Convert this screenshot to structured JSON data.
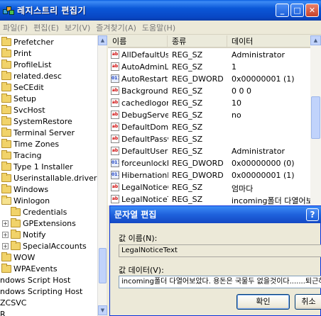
{
  "window": {
    "title": "레지스트리 편집기"
  },
  "menu": [
    {
      "label": "파일(F)"
    },
    {
      "label": "편집(E)"
    },
    {
      "label": "보기(V)"
    },
    {
      "label": "즐겨찾기(A)"
    },
    {
      "label": "도움말(H)"
    }
  ],
  "tree": {
    "items": [
      {
        "label": "Prefetcher"
      },
      {
        "label": "Print"
      },
      {
        "label": "ProfileList"
      },
      {
        "label": "related.desc"
      },
      {
        "label": "SeCEdit"
      },
      {
        "label": "Setup"
      },
      {
        "label": "SvcHost"
      },
      {
        "label": "SystemRestore"
      },
      {
        "label": "Terminal Server"
      },
      {
        "label": "Time Zones"
      },
      {
        "label": "Tracing"
      },
      {
        "label": "Type 1 Installer"
      },
      {
        "label": "Userinstallable.drivers"
      },
      {
        "label": "Windows"
      },
      {
        "label": "Winlogon"
      },
      {
        "label": "Credentials"
      },
      {
        "label": "GPExtensions"
      },
      {
        "label": "Notify"
      },
      {
        "label": "SpecialAccounts"
      },
      {
        "label": "WOW"
      },
      {
        "label": "WPAEvents"
      },
      {
        "label": "ndows Script Host"
      },
      {
        "label": "ndows Scripting Host"
      },
      {
        "label": "ZCSVC"
      },
      {
        "label": "R"
      }
    ]
  },
  "list": {
    "columns": {
      "name": "이름",
      "type": "종류",
      "data": "데이터"
    },
    "rows": [
      {
        "name": "AllDefaultUser...",
        "type": "REG_SZ",
        "data": "Administrator",
        "icon": "sz"
      },
      {
        "name": "AutoAdminLogon",
        "type": "REG_SZ",
        "data": "1",
        "icon": "sz"
      },
      {
        "name": "AutoRestartShell",
        "type": "REG_DWORD",
        "data": "0x00000001 (1)",
        "icon": "dw"
      },
      {
        "name": "Background",
        "type": "REG_SZ",
        "data": "0 0 0",
        "icon": "sz"
      },
      {
        "name": "cachedlogons...",
        "type": "REG_SZ",
        "data": "10",
        "icon": "sz"
      },
      {
        "name": "DebugServerC...",
        "type": "REG_SZ",
        "data": "no",
        "icon": "sz"
      },
      {
        "name": "DefaultDomain...",
        "type": "REG_SZ",
        "data": "",
        "icon": "sz"
      },
      {
        "name": "DefaultPassword",
        "type": "REG_SZ",
        "data": "",
        "icon": "sz"
      },
      {
        "name": "DefaultUserNa...",
        "type": "REG_SZ",
        "data": "Administrator",
        "icon": "sz"
      },
      {
        "name": "forceunlocklogon",
        "type": "REG_DWORD",
        "data": "0x00000000 (0)",
        "icon": "dw"
      },
      {
        "name": "HibernationPre...",
        "type": "REG_DWORD",
        "data": "0x00000001 (1)",
        "icon": "dw"
      },
      {
        "name": "LegalNoticeCa...",
        "type": "REG_SZ",
        "data": "엄마다",
        "icon": "sz"
      },
      {
        "name": "LegalNoticeText",
        "type": "REG_SZ",
        "data": "incoming폴더 다열어보았다.",
        "icon": "sz"
      }
    ]
  },
  "dialog": {
    "title": "문자열 편집",
    "help": "?",
    "name_label": "값 이름(N):",
    "name_value": "LegalNoticeText",
    "data_label": "값 데이터(V):",
    "data_value": "incoming폴더 다열어보았다. 용돈은 국물두 없을것이다.......퇴근하기전까지",
    "ok_label": "확인",
    "cancel_label": "취소"
  },
  "icon_colors": {
    "sz": "#cc0000",
    "dword": "#1a3fbf",
    "folder": "#f1d36a"
  }
}
